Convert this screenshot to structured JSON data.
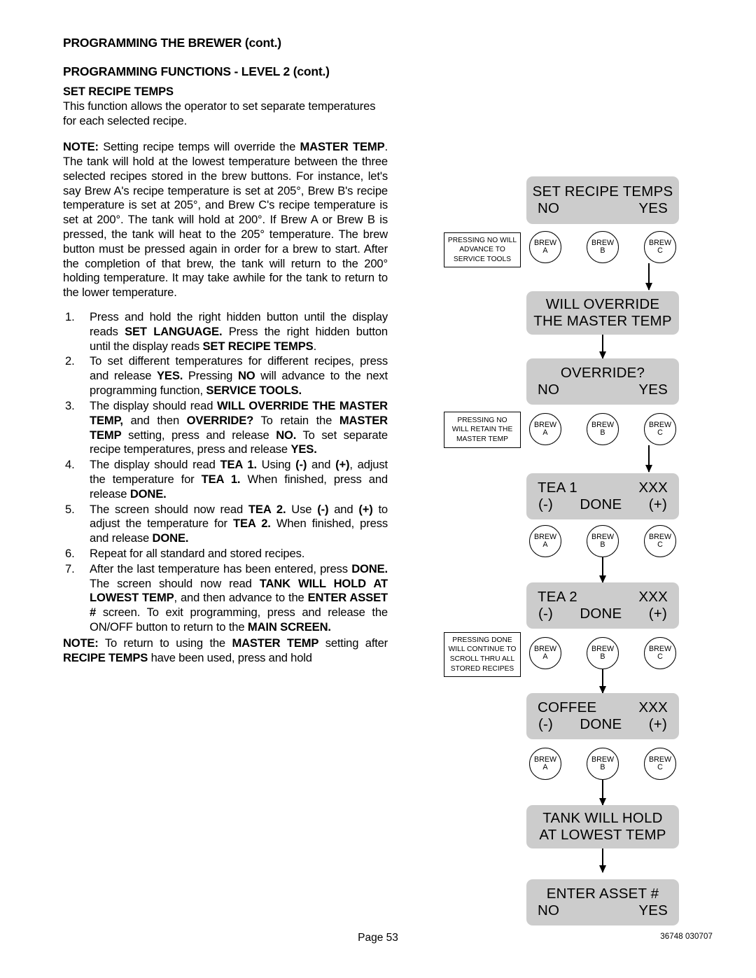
{
  "document": {
    "header_main": "PROGRAMMING THE BREWER (cont.)",
    "header_sub": "PROGRAMMING FUNCTIONS - LEVEL  2 (cont.)",
    "section_title": "SET RECIPE TEMPS",
    "intro": "This function allows the operator to set separate temperatures for each selected recipe.",
    "page_number": "Page 53",
    "doc_code": "36748 030707"
  },
  "note_top": {
    "label": "NOTE:",
    "text": " Setting recipe temps will override the MASTER TEMP. The tank will hold at the lowest temperature between the three selected recipes stored in the brew buttons. For instance, let's say Brew A's recipe temperature is set at 205°, Brew B's recipe temperature is set at 205°, and Brew C's recipe temperature is set at 200°. The tank will hold at 200°. If Brew A or Brew B is pressed, the tank will heat to the 205° temperature. The brew button must be pressed again in order for a brew to start. After the completion of that brew, the tank will return to the 200° holding temperature. It may take awhile for the tank to return to the lower temperature."
  },
  "steps": [
    {
      "num": "1.",
      "text": "Press and hold the right hidden button until the display reads SET LANGUAGE. Press the right hidden button until the display reads SET RECIPE TEMPS."
    },
    {
      "num": "2.",
      "text": "To set different temperatures for different recipes, press and release YES. Pressing NO will advance to the next programming function, SERVICE TOOLS."
    },
    {
      "num": "3.",
      "text": "The display should read WILL OVERRIDE THE MASTER TEMP, and then OVERRIDE? To retain the MASTER TEMP setting, press and release NO.  To set separate recipe temperatures, press and release YES."
    },
    {
      "num": "4.",
      "text": "The display should read TEA 1. Using (-) and (+), adjust the temperature for TEA 1. When finished, press and release DONE."
    },
    {
      "num": "5.",
      "text": "The screen should now read TEA 2. Use (-) and (+) to adjust the temperature for TEA 2. When finished, press and release DONE."
    },
    {
      "num": "6.",
      "text": "Repeat for all standard and stored recipes."
    },
    {
      "num": "7.",
      "text": "After the last temperature has been entered, press DONE. The screen should now read TANK WILL HOLD AT LOWEST TEMP, and then advance to the ENTER ASSET # screen. To exit programming, press and release the ON/OFF button to return to the MAIN SCREEN."
    }
  ],
  "note_bottom": {
    "label": "NOTE:",
    "text": "  To return to using the MASTER TEMP setting after RECIPE TEMPS have been used, press and hold"
  },
  "flowchart": {
    "screens": [
      {
        "id": "set-recipe-temps",
        "line1": "SET RECIPE TEMPS",
        "left": "NO",
        "right": "YES"
      },
      {
        "id": "will-override",
        "line1": "WILL OVERRIDE",
        "line2": "THE MASTER TEMP"
      },
      {
        "id": "override",
        "line1": "OVERRIDE?",
        "left": "NO",
        "right": "YES"
      },
      {
        "id": "tea-1",
        "left1": "TEA 1",
        "right1": "XXX",
        "minus": "(-)",
        "done": "DONE",
        "plus": "(+)"
      },
      {
        "id": "tea-2",
        "left1": "TEA 2",
        "right1": "XXX",
        "minus": "(-)",
        "done": "DONE",
        "plus": "(+)"
      },
      {
        "id": "coffee",
        "left1": "COFFEE",
        "right1": "XXX",
        "minus": "(-)",
        "done": "DONE",
        "plus": "(+)"
      },
      {
        "id": "tank-will-hold",
        "line1": "TANK WILL HOLD",
        "line2": "AT LOWEST TEMP"
      },
      {
        "id": "enter-asset",
        "line1": "ENTER ASSET #",
        "left": "NO",
        "right": "YES"
      }
    ],
    "brew_buttons": {
      "a_line1": "BREW",
      "a_line2": "A",
      "b_line1": "BREW",
      "b_line2": "B",
      "c_line1": "BREW",
      "c_line2": "C"
    },
    "callouts": [
      {
        "id": "callout-service-tools",
        "lines": [
          "PRESSING NO WILL",
          "ADVANCE TO",
          "SERVICE TOOLS"
        ]
      },
      {
        "id": "callout-retain-master",
        "lines": [
          "PRESSING NO",
          "WILL RETAIN THE",
          "MASTER TEMP"
        ]
      },
      {
        "id": "callout-scroll-recipes",
        "lines": [
          "PRESSING DONE",
          "WILL CONTINUE TO",
          "SCROLL THRU ALL",
          "STORED RECIPES"
        ]
      }
    ]
  },
  "colors": {
    "lcd_background": "#cccccc",
    "text": "#000000",
    "page_background": "#ffffff"
  }
}
